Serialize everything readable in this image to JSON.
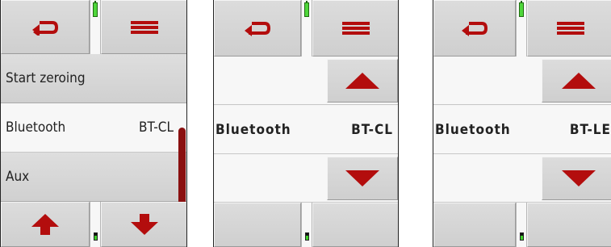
{
  "colors": {
    "icon_red": "#b30d0d",
    "button_gray": "#d6d6d6",
    "battery_green": "#4fd73b",
    "scrollbar": "#8a1010"
  },
  "icons": {
    "back": "return-arrow-icon",
    "menu": "menu-lines-icon",
    "up": "arrow-up-icon",
    "down": "arrow-down-icon",
    "battery": "battery-icon"
  },
  "screen_1": {
    "menu_items": [
      {
        "label": "Start zeroing",
        "value": ""
      },
      {
        "label": "Bluetooth",
        "value": "BT-CL"
      },
      {
        "label": "Aux",
        "value": ""
      }
    ]
  },
  "screen_2": {
    "setting": {
      "label": "Bluetooth",
      "value": "BT-CL"
    }
  },
  "screen_3": {
    "setting": {
      "label": "Bluetooth",
      "value": "BT-LE"
    }
  }
}
